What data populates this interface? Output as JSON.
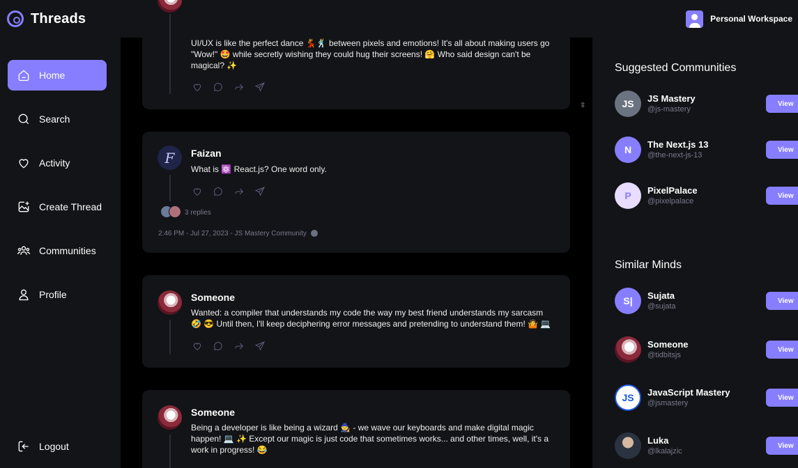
{
  "app": {
    "title": "Threads",
    "workspace_label": "Personal Workspace"
  },
  "nav": {
    "items": [
      {
        "label": "Home",
        "icon": "home-icon"
      },
      {
        "label": "Search",
        "icon": "search-icon"
      },
      {
        "label": "Activity",
        "icon": "heart-icon"
      },
      {
        "label": "Create Thread",
        "icon": "image-plus-icon"
      },
      {
        "label": "Communities",
        "icon": "users-icon"
      },
      {
        "label": "Profile",
        "icon": "user-icon"
      }
    ],
    "logout_label": "Logout"
  },
  "feed": {
    "threads": [
      {
        "author": "",
        "content": "UI/UX is like the perfect dance 💃🕺 between pixels and emotions! It's all about making users go \"Wow!\" 🤩 while secretly wishing they could hug their screens! 🤗 Who said design can't be magical? ✨"
      },
      {
        "author": "Faizan",
        "content": "What is ⚛️ React.js? One word only.",
        "replies": "3 replies",
        "meta": "2:46 PM - Jul 27, 2023 - JS Mastery Community"
      },
      {
        "author": "Someone",
        "content": "Wanted: a compiler that understands my code the way my best friend understands my sarcasm 🤣 😎 Until then, I'll keep deciphering error messages and pretending to understand them! 🤷 💻"
      },
      {
        "author": "Someone",
        "content": "Being a developer is like being a wizard 🧙 - we wave our keyboards and make digital magic happen! 💻 ✨ Except our magic is just code that sometimes works... and other times, well, it's a work in progress! 😂"
      }
    ]
  },
  "sidebar": {
    "communities_title": "Suggested Communities",
    "communities": [
      {
        "name": "JS Mastery",
        "handle": "@js-mastery",
        "avatar_text": "JS",
        "color": "#6b7280"
      },
      {
        "name": "The Next.js 13",
        "handle": "@the-next-js-13",
        "avatar_text": "N",
        "color": "#877EFF"
      },
      {
        "name": "PixelPalace",
        "handle": "@pixelpalace",
        "avatar_text": "P",
        "color": "#e8dcff"
      }
    ],
    "similar_title": "Similar Minds",
    "users": [
      {
        "name": "Sujata",
        "handle": "@sujata",
        "avatar_text": "S|",
        "color": "#877EFF"
      },
      {
        "name": "Someone",
        "handle": "@tidbitsjs",
        "avatar_text": "",
        "color": "#8a2a3a"
      },
      {
        "name": "JavaScript Mastery",
        "handle": "@jsmastery",
        "avatar_text": "JS",
        "color": "#ffffff"
      },
      {
        "name": "Luka",
        "handle": "@lkalajzic",
        "avatar_text": "",
        "color": "#4b5563"
      }
    ],
    "view_label": "View"
  },
  "colors": {
    "accent": "#877EFF",
    "panel": "#121417",
    "background": "#000000"
  }
}
